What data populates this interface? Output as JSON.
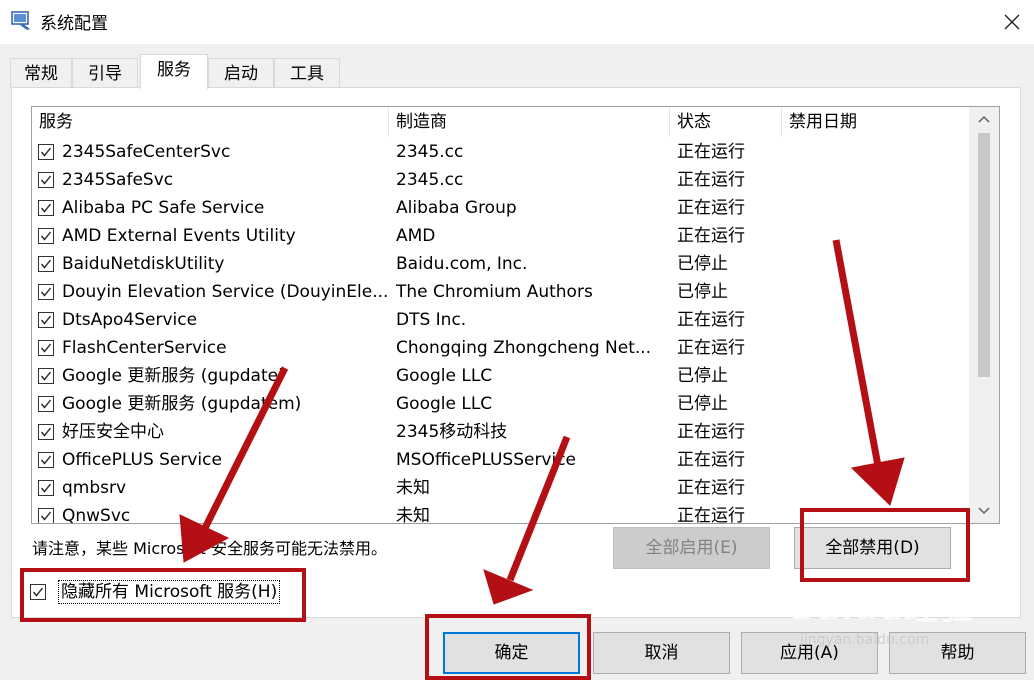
{
  "window": {
    "title": "系统配置",
    "icon": "msconfig-icon",
    "close_glyph": "✕"
  },
  "tabs": [
    "常规",
    "引导",
    "服务",
    "启动",
    "工具"
  ],
  "active_tab": "服务",
  "columns": [
    "服务",
    "制造商",
    "状态",
    "禁用日期"
  ],
  "rows": [
    {
      "service": "2345SafeCenterSvc",
      "vendor": "2345.cc",
      "status": "正在运行",
      "date": ""
    },
    {
      "service": "2345SafeSvc",
      "vendor": "2345.cc",
      "status": "正在运行",
      "date": ""
    },
    {
      "service": "Alibaba PC Safe Service",
      "vendor": "Alibaba Group",
      "status": "正在运行",
      "date": ""
    },
    {
      "service": "AMD External Events Utility",
      "vendor": "AMD",
      "status": "正在运行",
      "date": ""
    },
    {
      "service": "BaiduNetdiskUtility",
      "vendor": "Baidu.com, Inc.",
      "status": "已停止",
      "date": ""
    },
    {
      "service": "Douyin Elevation Service (DouyinEle...",
      "vendor": "The Chromium Authors",
      "status": "已停止",
      "date": ""
    },
    {
      "service": "DtsApo4Service",
      "vendor": "DTS Inc.",
      "status": "正在运行",
      "date": ""
    },
    {
      "service": "FlashCenterService",
      "vendor": "Chongqing Zhongcheng Net...",
      "status": "正在运行",
      "date": ""
    },
    {
      "service": "Google 更新服务 (gupdate)",
      "vendor": "Google LLC",
      "status": "已停止",
      "date": ""
    },
    {
      "service": "Google 更新服务 (gupdatem)",
      "vendor": "Google LLC",
      "status": "已停止",
      "date": ""
    },
    {
      "service": "好压安全中心",
      "vendor": "2345移动科技",
      "status": "正在运行",
      "date": ""
    },
    {
      "service": "OfficePLUS Service",
      "vendor": "MSOfficePLUSService",
      "status": "正在运行",
      "date": ""
    },
    {
      "service": "qmbsrv",
      "vendor": "未知",
      "status": "正在运行",
      "date": ""
    },
    {
      "service": "QnwSvc",
      "vendor": "未知",
      "status": "正在运行",
      "date": ""
    }
  ],
  "note": "请注意，某些 Microsoft 安全服务可能无法禁用。",
  "buttons": {
    "enable_all": "全部启用(E)",
    "disable_all": "全部禁用(D)",
    "ok": "确定",
    "cancel": "取消",
    "apply": "应用(A)",
    "help": "帮助"
  },
  "hide_ms_label": "隐藏所有 Microsoft 服务(H)",
  "hide_ms_checked": true,
  "watermark": {
    "brand": "Baidu经验",
    "url": "jingyan.baidu.com"
  },
  "colors": {
    "annotation_red": "#b40f14",
    "accent": "#0078d7"
  }
}
